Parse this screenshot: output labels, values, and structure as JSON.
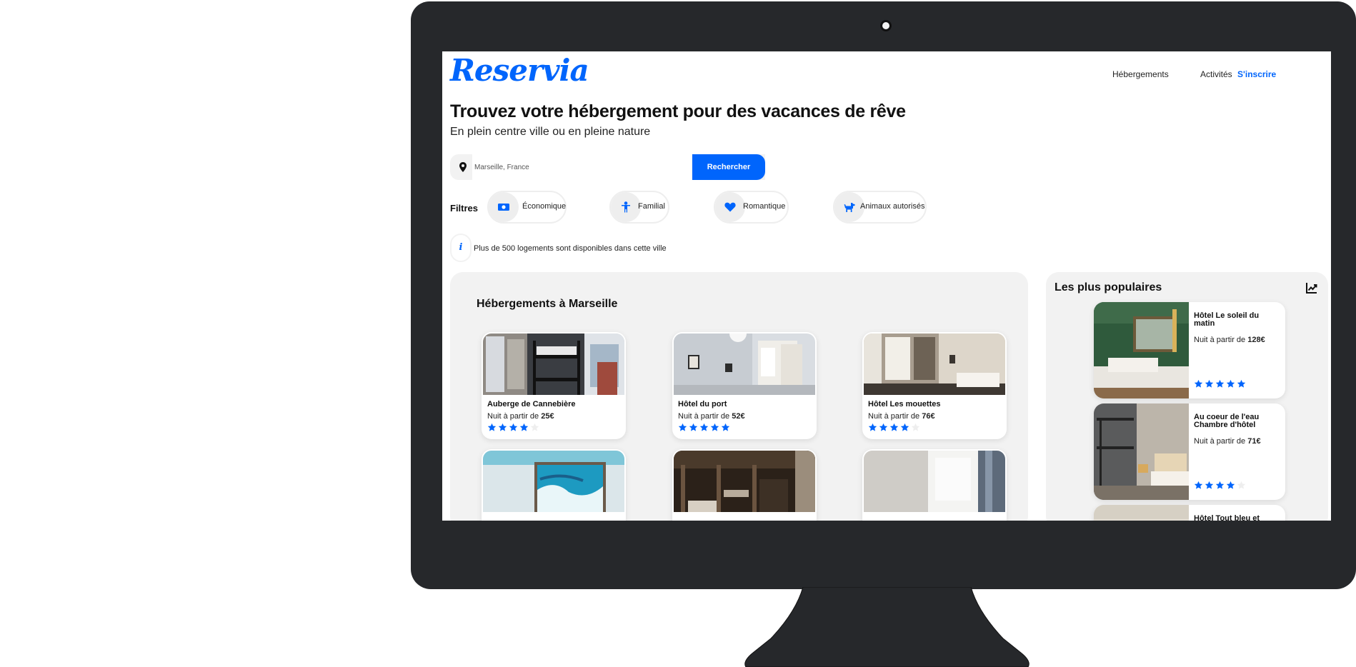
{
  "app": {
    "logo": "Reservia"
  },
  "nav": {
    "items": [
      {
        "label": "Hébergements"
      },
      {
        "label": "Activités"
      },
      {
        "label": "S'inscrire"
      }
    ]
  },
  "hero": {
    "title": "Trouvez votre hébergement pour des vacances de rêve",
    "subtitle": "En plein centre ville ou en pleine nature"
  },
  "search": {
    "value": "Marseille, France",
    "button_label": "Rechercher",
    "icon": "location-pin-icon"
  },
  "filters": {
    "label": "Filtres",
    "items": [
      {
        "label": "Économique",
        "icon": "money-icon"
      },
      {
        "label": "Familial",
        "icon": "child-icon"
      },
      {
        "label": "Romantique",
        "icon": "heart-icon"
      },
      {
        "label": "Animaux autorisés",
        "icon": "dog-icon"
      }
    ]
  },
  "info": {
    "icon": "info-icon",
    "text": "Plus de 500 logements sont disponibles dans cette ville"
  },
  "listings": {
    "title": "Hébergements à Marseille",
    "price_prefix": "Nuit à partir de",
    "items": [
      {
        "name": "Auberge de Cannebière",
        "price": "25€",
        "rating": 4
      },
      {
        "name": "Hôtel du port",
        "price": "52€",
        "rating": 5
      },
      {
        "name": "Hôtel Les mouettes",
        "price": "76€",
        "rating": 4
      },
      {
        "name": "",
        "price": "",
        "rating": 0
      },
      {
        "name": "",
        "price": "",
        "rating": 0
      },
      {
        "name": "",
        "price": "",
        "rating": 0
      }
    ]
  },
  "popular": {
    "title": "Les plus populaires",
    "icon": "trend-chart-icon",
    "price_prefix": "Nuit à partir de",
    "items": [
      {
        "name": "Hôtel Le soleil du matin",
        "price": "128€",
        "rating": 5
      },
      {
        "name": "Au coeur de l'eau Chambre d'hôtel",
        "price": "71€",
        "rating": 4
      },
      {
        "name": "Hôtel Tout bleu et",
        "price": "",
        "rating": 0
      }
    ]
  },
  "colors": {
    "accent": "#0065fc",
    "panel_bg": "#f2f2f2",
    "monitor": "#26282b"
  }
}
